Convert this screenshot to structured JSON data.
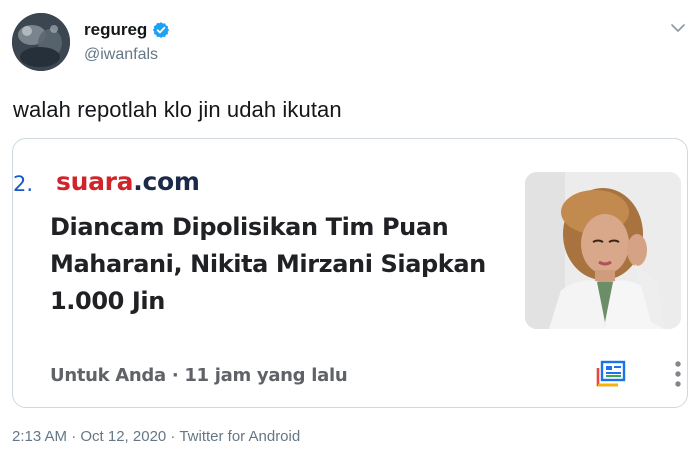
{
  "author": {
    "display_name": "regureg",
    "handle": "@iwanfals"
  },
  "tweet": {
    "text": "walah repotlah klo jin udah ikutan",
    "timestamp": "2:13 AM · Oct 12, 2020 · Twitter for Android"
  },
  "card": {
    "rank": "2.",
    "source_part1": "suara",
    "source_part2": ".com",
    "headline_line1": "Diancam Dipolisikan Tim Puan",
    "headline_line2": "Maharani, Nikita Mirzani Siapkan",
    "headline_line3": "1.000 Jin",
    "meta": "Untuk Anda · 11 jam yang lalu"
  },
  "colors": {
    "verified": "#1da1f2",
    "rank_blue": "#1a57c9",
    "brand_red": "#d1232a",
    "brand_navy": "#1c2a4a"
  },
  "icons": [
    "verified-badge-icon",
    "chevron-down-icon",
    "news-stack-icon",
    "more-vertical-icon"
  ]
}
